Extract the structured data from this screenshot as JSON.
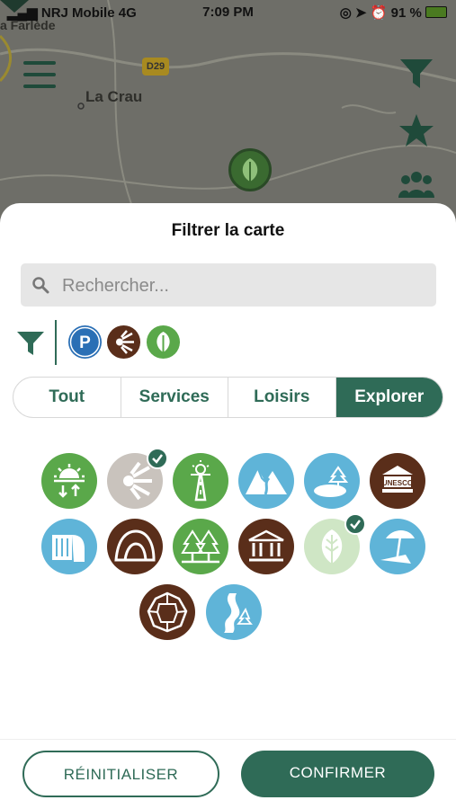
{
  "status_bar": {
    "carrier": "NRJ Mobile",
    "network": "4G",
    "time": "7:09 PM",
    "battery": "91 %"
  },
  "map": {
    "town_label": "La Crau",
    "partial_label": "a Farlède",
    "road_badge": "D29"
  },
  "sheet": {
    "title": "Filtrer la carte",
    "search_placeholder": "Rechercher...",
    "active_filters": [
      "parking-icon",
      "viewpoint-icon",
      "nature-leaf-icon"
    ],
    "tabs": [
      {
        "label": "Tout",
        "active": false
      },
      {
        "label": "Services",
        "active": false
      },
      {
        "label": "Loisirs",
        "active": false
      },
      {
        "label": "Explorer",
        "active": true
      }
    ],
    "categories": [
      {
        "icon": "sunrise-icon",
        "color": "#5aa84a",
        "selected": false
      },
      {
        "icon": "viewpoint-icon",
        "color": "#c9c3bd",
        "selected": true
      },
      {
        "icon": "scenic-road-icon",
        "color": "#5aa84a",
        "selected": false
      },
      {
        "icon": "mountains-icon",
        "color": "#5fb4d8",
        "selected": false
      },
      {
        "icon": "lake-icon",
        "color": "#5fb4d8",
        "selected": false
      },
      {
        "icon": "unesco-icon",
        "color": "#5a2e1a",
        "selected": false
      },
      {
        "icon": "waterfall-icon",
        "color": "#5fb4d8",
        "selected": false
      },
      {
        "icon": "cave-icon",
        "color": "#5a2e1a",
        "selected": false
      },
      {
        "icon": "forest-icon",
        "color": "#5aa84a",
        "selected": false
      },
      {
        "icon": "monument-icon",
        "color": "#5a2e1a",
        "selected": false
      },
      {
        "icon": "nature-leaf-icon",
        "color": "#cfe6c5",
        "selected": true
      },
      {
        "icon": "beach-icon",
        "color": "#5fb4d8",
        "selected": false
      },
      {
        "icon": "chasm-icon",
        "color": "#5a2e1a",
        "selected": false
      },
      {
        "icon": "river-icon",
        "color": "#5fb4d8",
        "selected": false
      }
    ],
    "unesco_text": "UNESCO",
    "reset_label": "RÉINITIALISER",
    "confirm_label": "CONFIRMER"
  },
  "colors": {
    "brand": "#2f6b57"
  }
}
